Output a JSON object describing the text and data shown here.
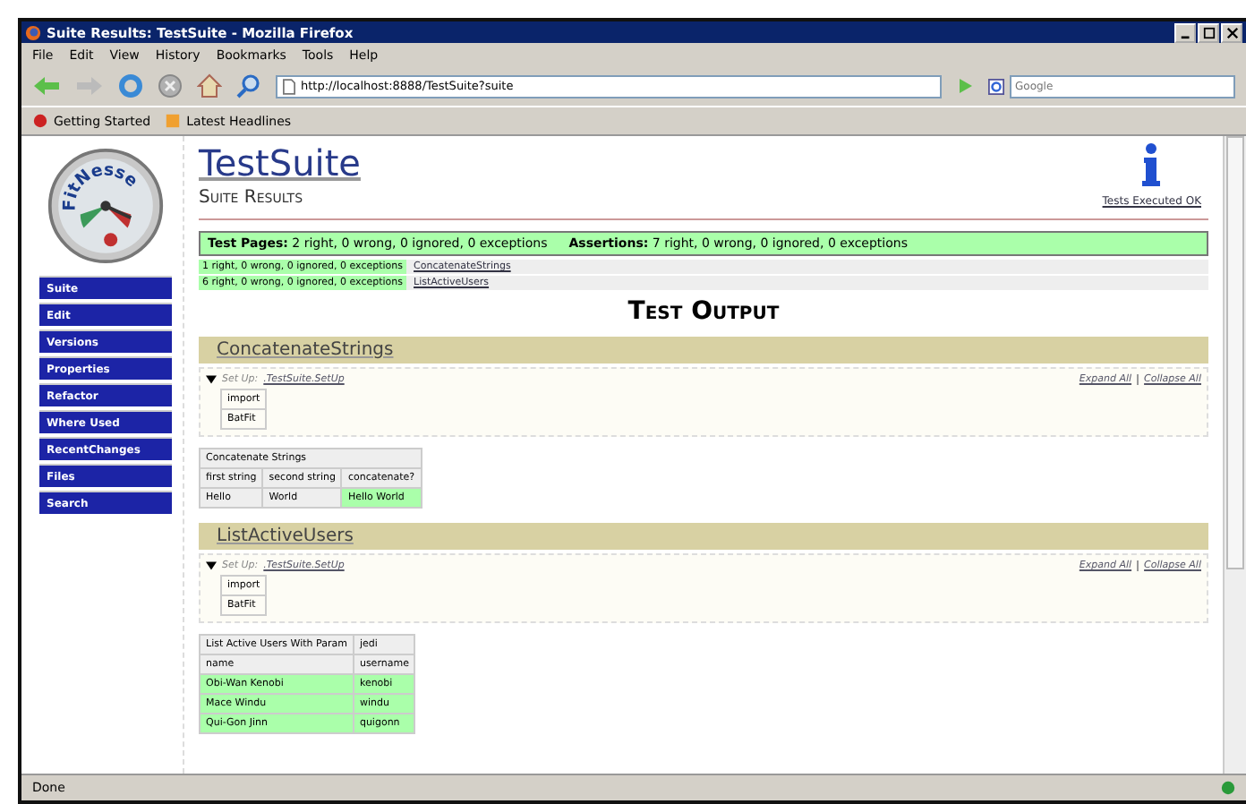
{
  "window": {
    "title": "Suite Results: TestSuite - Mozilla Firefox"
  },
  "menu": [
    "File",
    "Edit",
    "View",
    "History",
    "Bookmarks",
    "Tools",
    "Help"
  ],
  "toolbar": {
    "url": "http://localhost:8888/TestSuite?suite",
    "search_placeholder": "Google"
  },
  "bookmarks": [
    "Getting Started",
    "Latest Headlines"
  ],
  "logo": {
    "text": "FitNesse"
  },
  "sidebar": {
    "items": [
      "Suite",
      "Edit",
      "Versions",
      "Properties",
      "Refactor",
      "Where Used",
      "RecentChanges",
      "Files",
      "Search"
    ]
  },
  "page": {
    "title": "TestSuite",
    "subtitle": "Suite Results",
    "status_link": "Tests Executed OK"
  },
  "summary": {
    "pass": true,
    "pages": "**Test Pages:** 2 right, 0 wrong, 0 ignored, 0 exceptions",
    "assertions": "**Assertions:** 7 right, 0 wrong, 0 ignored, 0 exceptions"
  },
  "results": [
    {
      "counts": "1 right, 0 wrong, 0 ignored, 0 exceptions",
      "link": "ConcatenateStrings",
      "pass": true
    },
    {
      "counts": "6 right, 0 wrong, 0 ignored, 0 exceptions",
      "link": "ListActiveUsers",
      "pass": true
    }
  ],
  "output_heading": "Test Output",
  "sections": [
    {
      "title": "ConcatenateStrings",
      "expanded": true,
      "setup_label": "Set Up:",
      "setup_link": ".TestSuite.SetUp",
      "expand_all": "Expand All",
      "collapse_all": "Collapse All",
      "setup_rows": [
        "import",
        "BatFit"
      ],
      "table": [
        [
          {
            "text": "Concatenate Strings",
            "pass": false
          }
        ],
        [
          {
            "text": "first string",
            "pass": false
          },
          {
            "text": "second string",
            "pass": false
          },
          {
            "text": "concatenate?",
            "pass": false
          }
        ],
        [
          {
            "text": "Hello",
            "pass": false
          },
          {
            "text": "World",
            "pass": false
          },
          {
            "text": "Hello World",
            "pass": true
          }
        ]
      ]
    },
    {
      "title": "ListActiveUsers",
      "expanded": true,
      "setup_label": "Set Up:",
      "setup_link": ".TestSuite.SetUp",
      "expand_all": "Expand All",
      "collapse_all": "Collapse All",
      "setup_rows": [
        "import",
        "BatFit"
      ],
      "table": [
        [
          {
            "text": "List Active Users With Param",
            "pass": false
          },
          {
            "text": "jedi",
            "pass": false
          }
        ],
        [
          {
            "text": "name",
            "pass": false
          },
          {
            "text": "username",
            "pass": false
          }
        ],
        [
          {
            "text": "Obi-Wan Kenobi",
            "pass": true
          },
          {
            "text": "kenobi",
            "pass": true
          }
        ],
        [
          {
            "text": "Mace Windu",
            "pass": true
          },
          {
            "text": "windu",
            "pass": true
          }
        ],
        [
          {
            "text": "Qui-Gon Jinn",
            "pass": true
          },
          {
            "text": "quigonn",
            "pass": true
          }
        ]
      ]
    }
  ],
  "status_bar": {
    "text": "Done"
  }
}
